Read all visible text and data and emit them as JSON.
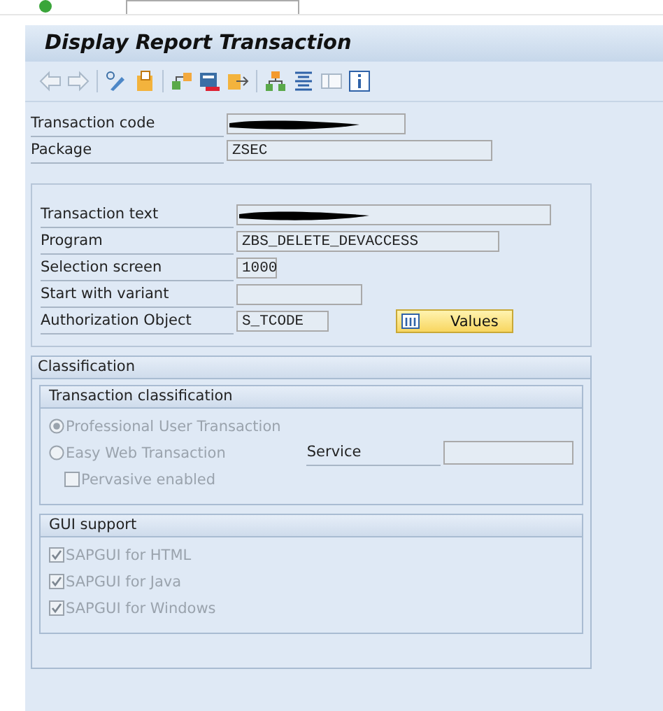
{
  "window": {
    "title": "Display Report Transaction"
  },
  "toolbar": [
    {
      "kind": "back",
      "disabled": true
    },
    {
      "kind": "forward",
      "disabled": true
    },
    {
      "kind": "sep"
    },
    {
      "kind": "edit",
      "disabled": false
    },
    {
      "kind": "other",
      "disabled": false
    },
    {
      "kind": "sep"
    },
    {
      "kind": "where-used",
      "disabled": false
    },
    {
      "kind": "program",
      "disabled": false
    },
    {
      "kind": "export",
      "disabled": false
    },
    {
      "kind": "sep"
    },
    {
      "kind": "hierarchy",
      "disabled": false
    },
    {
      "kind": "list",
      "disabled": false
    },
    {
      "kind": "panel",
      "disabled": true
    },
    {
      "kind": "info",
      "disabled": false
    }
  ],
  "header_fields": [
    {
      "label": "Transaction code",
      "redacted": true
    },
    {
      "label": "Package",
      "value": "ZSEC",
      "redacted": false
    }
  ],
  "details_fields": [
    {
      "label": "Transaction text",
      "redacted": true
    },
    {
      "label": "Program",
      "value": "ZBS_DELETE_DEVACCESS",
      "redacted": false
    },
    {
      "label": "Selection screen",
      "value": "1000",
      "redacted": false
    },
    {
      "label": "Start with variant",
      "redacted": false
    },
    {
      "label": "Authorization Object",
      "value": "S_TCODE",
      "redacted": false
    }
  ],
  "values_button": {
    "label": "Values"
  },
  "classification": {
    "title": "Classification",
    "transaction_classification": {
      "title": "Transaction classification",
      "radios": [
        {
          "label": "Professional User Transaction",
          "selected": true,
          "disabled": true
        },
        {
          "label": "Easy Web Transaction",
          "selected": false,
          "disabled": true
        }
      ],
      "pervasive": {
        "label": "Pervasive enabled",
        "checked": false,
        "disabled": true
      },
      "service": {
        "label": "Service"
      }
    },
    "gui_support": {
      "title": "GUI support",
      "checkboxes": [
        {
          "label": "SAPGUI for HTML",
          "checked": true,
          "disabled": true
        },
        {
          "label": "SAPGUI for Java",
          "checked": true,
          "disabled": true
        },
        {
          "label": "SAPGUI for Windows",
          "checked": true,
          "disabled": true
        }
      ]
    }
  }
}
